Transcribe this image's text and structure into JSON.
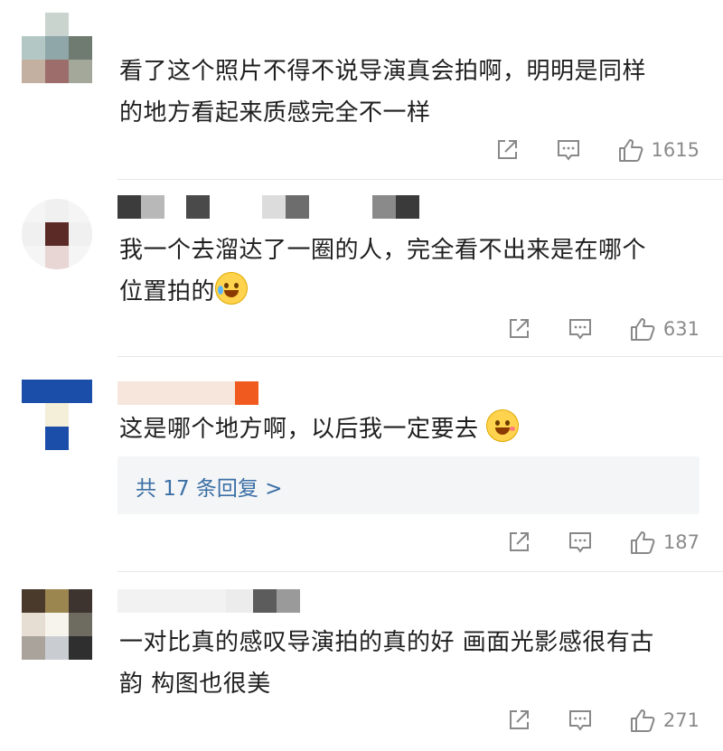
{
  "comments": [
    {
      "text_line1": "看了这个照片不得不说导演真会拍啊，明明是同样",
      "text_line2": "的地方看起来质感完全不一样",
      "likes": "1615"
    },
    {
      "text_line1": "我一个去溜达了一圈的人，完全看不出来是在哪个",
      "text_line2": "位置拍的",
      "likes": "631"
    },
    {
      "text_line1": "这是哪个地方啊，以后我一定要去",
      "reply_label": "共 17 条回复 >",
      "likes": "187"
    },
    {
      "text_line1": "一对比真的感叹导演拍的真的好 画面光影感很有古",
      "text_line2": "韵 构图也很美",
      "likes": "271"
    }
  ],
  "icons": {
    "share": "share-icon",
    "comment": "comment-icon",
    "like": "thumbs-up-icon"
  },
  "colors": {
    "link": "#3b6fa5",
    "meta": "#888888",
    "reply_bg": "#f4f5f7"
  }
}
